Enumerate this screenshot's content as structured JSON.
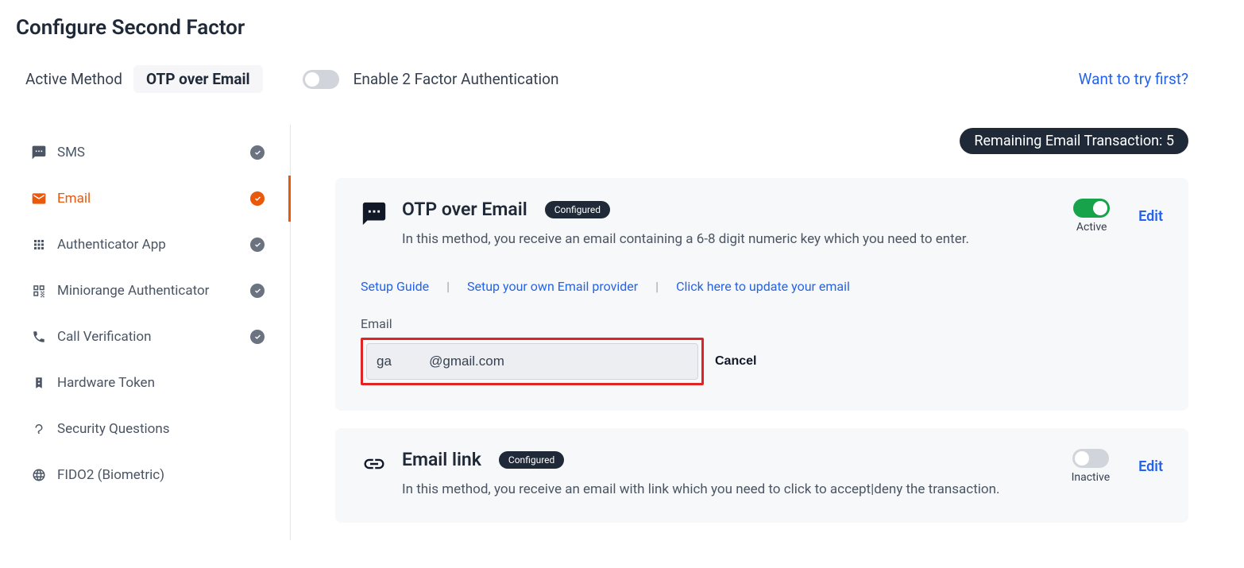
{
  "page_title": "Configure Second Factor",
  "active_method_label": "Active Method",
  "active_method_value": "OTP over Email",
  "enable_2fa_label": "Enable 2 Factor Authentication",
  "try_first_label": "Want to try first?",
  "sidebar": {
    "items": [
      {
        "label": "SMS",
        "configured": true
      },
      {
        "label": "Email",
        "configured": true,
        "active": true
      },
      {
        "label": "Authenticator App",
        "configured": true
      },
      {
        "label": "Miniorange Authenticator",
        "configured": true
      },
      {
        "label": "Call Verification",
        "configured": true
      },
      {
        "label": "Hardware Token",
        "configured": false
      },
      {
        "label": "Security Questions",
        "configured": false
      },
      {
        "label": "FIDO2 (Biometric)",
        "configured": false
      }
    ]
  },
  "transaction_badge": "Remaining Email Transaction: 5",
  "card_otp": {
    "title": "OTP over Email",
    "badge": "Configured",
    "description": "In this method, you receive an email containing a 6-8 digit numeric key which you need to enter.",
    "toggle_state": "Active",
    "edit_label": "Edit",
    "links": {
      "setup_guide": "Setup Guide",
      "own_provider": "Setup your own Email provider",
      "update_email": "Click here to update your email"
    },
    "email_label": "Email",
    "email_value": "ga          @gmail.com",
    "cancel_label": "Cancel"
  },
  "card_link": {
    "title": "Email link",
    "badge": "Configured",
    "description": "In this method, you receive an email with link which you need to click to accept|deny the transaction.",
    "toggle_state": "Inactive",
    "edit_label": "Edit"
  }
}
